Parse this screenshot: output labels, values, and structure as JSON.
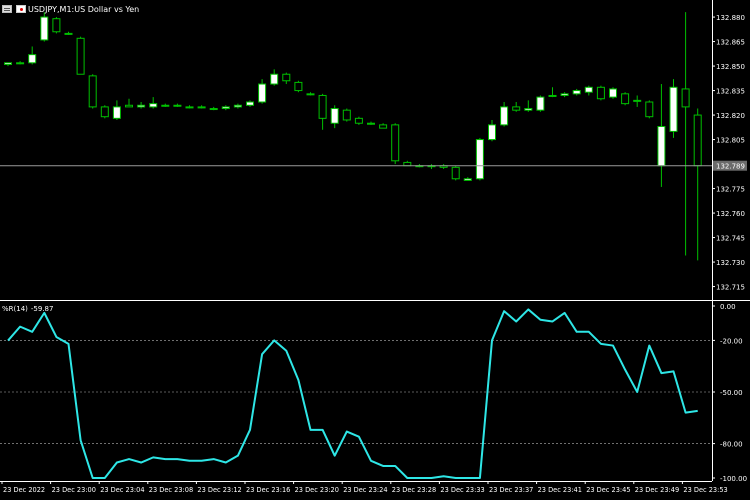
{
  "chart_window": {
    "symbol": "USDJPY",
    "timeframe": "M1",
    "description": "US Dollar vs Yen",
    "separator": ", ",
    "desc_sep": ":  "
  },
  "colors": {
    "background": "#000000",
    "bull_candle": "#ffffff",
    "bear_candle": "#000000",
    "candle_outline": "#00c000",
    "indicator_line": "#2ee6e6",
    "grid": "#ffffff",
    "axis_text": "#ffffff",
    "price_label_bg": "#6b6b6b"
  },
  "indicator": {
    "name": "%R(14)",
    "value": "-59.87"
  },
  "current_price": "132.789",
  "price_axis": {
    "ticks": [
      "132.880",
      "132.865",
      "132.850",
      "132.835",
      "132.820",
      "132.805",
      "132.775",
      "132.760",
      "132.745",
      "132.730",
      "132.715"
    ],
    "range": [
      132.708,
      132.888
    ]
  },
  "indicator_axis": {
    "ticks": [
      "0.00",
      "-20.00",
      "-50.00",
      "-80.00",
      "-100.00"
    ],
    "levels": [
      -20,
      -50,
      -80
    ],
    "range": [
      -100,
      0
    ]
  },
  "time_axis": {
    "labels": [
      "23 Dec 2022",
      "23 Dec 23:00",
      "23 Dec 23:04",
      "23 Dec 23:08",
      "23 Dec 23:12",
      "23 Dec 23:16",
      "23 Dec 23:20",
      "23 Dec 23:24",
      "23 Dec 23:28",
      "23 Dec 23:33",
      "23 Dec 23:37",
      "23 Dec 23:41",
      "23 Dec 23:45",
      "23 Dec 23:49",
      "23 Dec 23:53"
    ]
  },
  "chart_data": {
    "type": "candlestick",
    "ylim": [
      132.708,
      132.888
    ],
    "candles": [
      {
        "o": 132.851,
        "h": 132.852,
        "l": 132.85,
        "c": 132.852
      },
      {
        "o": 132.852,
        "h": 132.853,
        "l": 132.851,
        "c": 132.852
      },
      {
        "o": 132.852,
        "h": 132.862,
        "l": 132.851,
        "c": 132.857
      },
      {
        "o": 132.866,
        "h": 132.883,
        "l": 132.865,
        "c": 132.88
      },
      {
        "o": 132.879,
        "h": 132.88,
        "l": 132.87,
        "c": 132.871
      },
      {
        "o": 132.87,
        "h": 132.871,
        "l": 132.869,
        "c": 132.87
      },
      {
        "o": 132.867,
        "h": 132.868,
        "l": 132.845,
        "c": 132.845
      },
      {
        "o": 132.844,
        "h": 132.845,
        "l": 132.824,
        "c": 132.825
      },
      {
        "o": 132.825,
        "h": 132.826,
        "l": 132.818,
        "c": 132.819
      },
      {
        "o": 132.818,
        "h": 132.829,
        "l": 132.817,
        "c": 132.825
      },
      {
        "o": 132.826,
        "h": 132.83,
        "l": 132.825,
        "c": 132.825
      },
      {
        "o": 132.825,
        "h": 132.828,
        "l": 132.824,
        "c": 132.826
      },
      {
        "o": 132.825,
        "h": 132.831,
        "l": 132.824,
        "c": 132.827
      },
      {
        "o": 132.826,
        "h": 132.827,
        "l": 132.825,
        "c": 132.826
      },
      {
        "o": 132.826,
        "h": 132.827,
        "l": 132.825,
        "c": 132.826
      },
      {
        "o": 132.825,
        "h": 132.826,
        "l": 132.824,
        "c": 132.825
      },
      {
        "o": 132.825,
        "h": 132.826,
        "l": 132.824,
        "c": 132.825
      },
      {
        "o": 132.824,
        "h": 132.825,
        "l": 132.823,
        "c": 132.824
      },
      {
        "o": 132.824,
        "h": 132.826,
        "l": 132.823,
        "c": 132.825
      },
      {
        "o": 132.825,
        "h": 132.827,
        "l": 132.824,
        "c": 132.826
      },
      {
        "o": 132.826,
        "h": 132.829,
        "l": 132.825,
        "c": 132.828
      },
      {
        "o": 132.828,
        "h": 132.842,
        "l": 132.827,
        "c": 132.839
      },
      {
        "o": 132.839,
        "h": 132.848,
        "l": 132.838,
        "c": 132.845
      },
      {
        "o": 132.845,
        "h": 132.846,
        "l": 132.839,
        "c": 132.841
      },
      {
        "o": 132.84,
        "h": 132.841,
        "l": 132.834,
        "c": 132.835
      },
      {
        "o": 132.833,
        "h": 132.834,
        "l": 132.832,
        "c": 132.833
      },
      {
        "o": 132.832,
        "h": 132.833,
        "l": 132.811,
        "c": 132.818
      },
      {
        "o": 132.815,
        "h": 132.826,
        "l": 132.812,
        "c": 132.824
      },
      {
        "o": 132.823,
        "h": 132.824,
        "l": 132.816,
        "c": 132.817
      },
      {
        "o": 132.818,
        "h": 132.819,
        "l": 132.814,
        "c": 132.815
      },
      {
        "o": 132.815,
        "h": 132.816,
        "l": 132.814,
        "c": 132.815
      },
      {
        "o": 132.814,
        "h": 132.815,
        "l": 132.812,
        "c": 132.812
      },
      {
        "o": 132.814,
        "h": 132.815,
        "l": 132.79,
        "c": 132.792
      },
      {
        "o": 132.791,
        "h": 132.792,
        "l": 132.789,
        "c": 132.789
      },
      {
        "o": 132.789,
        "h": 132.79,
        "l": 132.788,
        "c": 132.789
      },
      {
        "o": 132.789,
        "h": 132.79,
        "l": 132.787,
        "c": 132.789
      },
      {
        "o": 132.789,
        "h": 132.79,
        "l": 132.787,
        "c": 132.788
      },
      {
        "o": 132.788,
        "h": 132.789,
        "l": 132.78,
        "c": 132.781
      },
      {
        "o": 132.78,
        "h": 132.782,
        "l": 132.78,
        "c": 132.781
      },
      {
        "o": 132.781,
        "h": 132.806,
        "l": 132.78,
        "c": 132.805
      },
      {
        "o": 132.805,
        "h": 132.817,
        "l": 132.804,
        "c": 132.814
      },
      {
        "o": 132.814,
        "h": 132.828,
        "l": 132.813,
        "c": 132.825
      },
      {
        "o": 132.825,
        "h": 132.828,
        "l": 132.822,
        "c": 132.823
      },
      {
        "o": 132.823,
        "h": 132.829,
        "l": 132.822,
        "c": 132.824
      },
      {
        "o": 132.823,
        "h": 132.832,
        "l": 132.822,
        "c": 132.831
      },
      {
        "o": 132.832,
        "h": 132.837,
        "l": 132.831,
        "c": 132.832
      },
      {
        "o": 132.832,
        "h": 132.834,
        "l": 132.831,
        "c": 132.833
      },
      {
        "o": 132.833,
        "h": 132.836,
        "l": 132.832,
        "c": 132.835
      },
      {
        "o": 132.834,
        "h": 132.838,
        "l": 132.832,
        "c": 132.837
      },
      {
        "o": 132.837,
        "h": 132.838,
        "l": 132.829,
        "c": 132.83
      },
      {
        "o": 132.831,
        "h": 132.837,
        "l": 132.83,
        "c": 132.836
      },
      {
        "o": 132.833,
        "h": 132.834,
        "l": 132.826,
        "c": 132.827
      },
      {
        "o": 132.829,
        "h": 132.832,
        "l": 132.825,
        "c": 132.829
      },
      {
        "o": 132.828,
        "h": 132.829,
        "l": 132.818,
        "c": 132.819
      },
      {
        "o": 132.789,
        "h": 132.839,
        "l": 132.776,
        "c": 132.813
      },
      {
        "o": 132.81,
        "h": 132.842,
        "l": 132.806,
        "c": 132.837
      },
      {
        "o": 132.836,
        "h": 132.883,
        "l": 132.734,
        "c": 132.825
      },
      {
        "o": 132.82,
        "h": 132.824,
        "l": 132.731,
        "c": 132.789
      }
    ],
    "wpr_values": [
      -20.1,
      -12.0,
      -15.0,
      -4.0,
      -18.0,
      -22.0,
      -78.0,
      -100.0,
      -100.0,
      -91.0,
      -89.0,
      -91.0,
      -88.0,
      -89.0,
      -89.0,
      -90.0,
      -90.0,
      -89.0,
      -91.0,
      -87.0,
      -72.0,
      -28.0,
      -20.0,
      -26.0,
      -43.0,
      -72.0,
      -72.0,
      -87.0,
      -73.0,
      -76.0,
      -90.0,
      -93.0,
      -93.0,
      -100.0,
      -100.0,
      -100.0,
      -99.0,
      -100.0,
      -100.0,
      -100.0,
      -20.0,
      -3.0,
      -9.0,
      -2.0,
      -8.0,
      -9.0,
      -4.0,
      -15.0,
      -15.0,
      -22.0,
      -23.0,
      -37.0,
      -50.0,
      -23.0,
      -39.0,
      -38.0,
      -62.0,
      -61.0
    ]
  }
}
